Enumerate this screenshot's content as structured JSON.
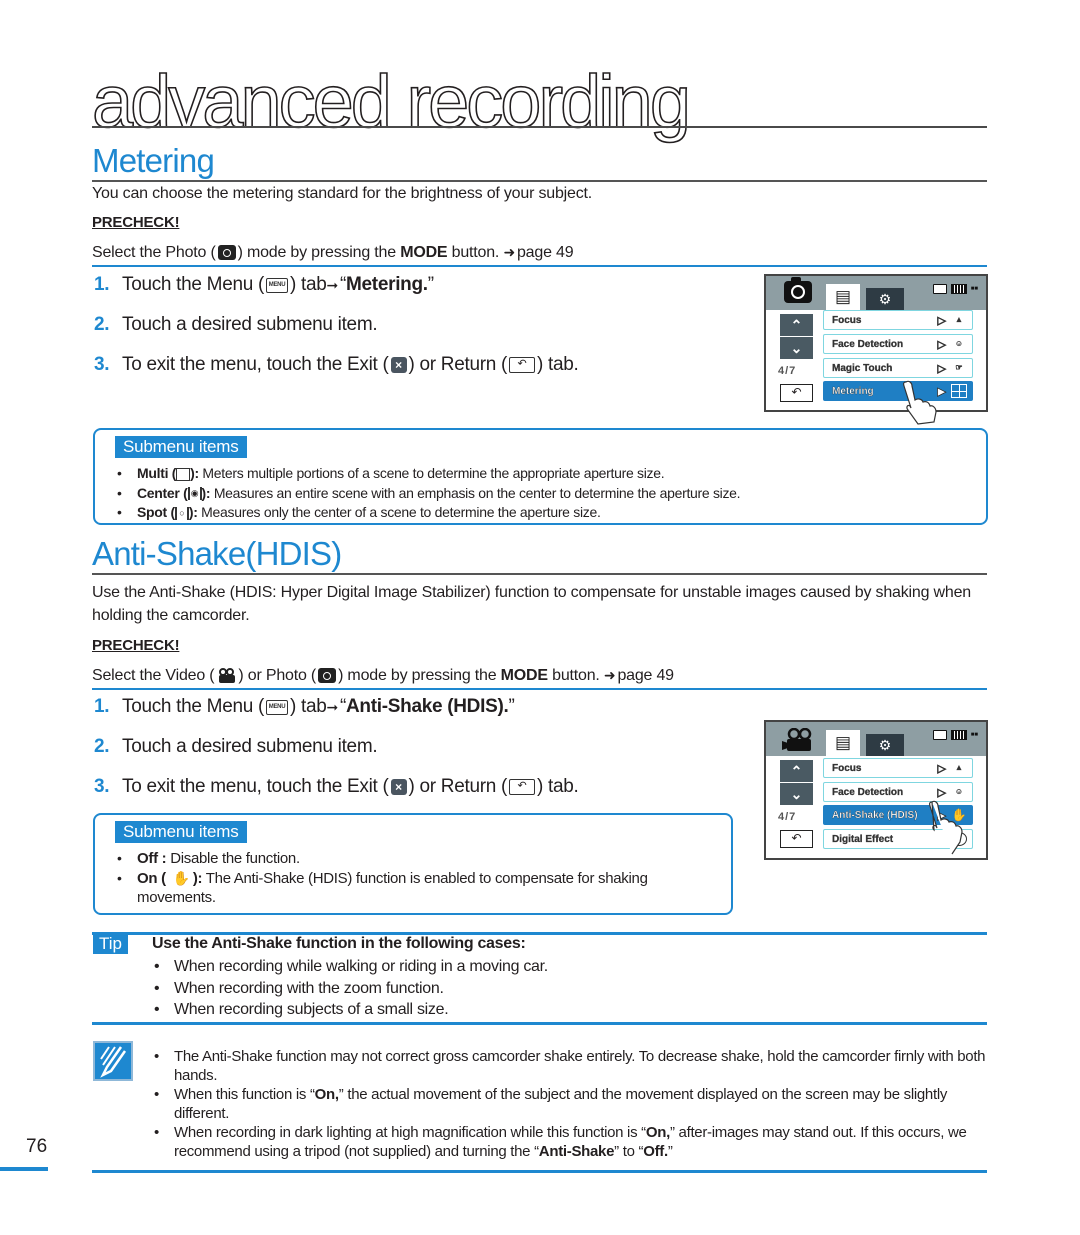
{
  "chapter": {
    "title": "advanced recording"
  },
  "metering": {
    "title": "Metering",
    "intro": "You can choose the metering standard for the brightness of your subject.",
    "precheck_label": "PRECHECK!",
    "precheck_pre": "Select the Photo (",
    "precheck_mid": ") mode by pressing the ",
    "precheck_mode": "MODE",
    "precheck_post": " button. ",
    "precheck_page": "page 49",
    "steps": [
      {
        "num": "1.",
        "pre": "Touch the Menu (",
        "icon": "MENU",
        "mid": ") tab ",
        "bold": "Metering.",
        "post": ""
      },
      {
        "num": "2.",
        "text": "Touch a desired submenu item."
      },
      {
        "num": "3.",
        "pre": "To exit the menu, touch the Exit (",
        "mid": ") or Return (",
        "post": ") tab."
      }
    ],
    "submenu_label": "Submenu items",
    "submenu": [
      {
        "name": "Multi (",
        "icon": "multi-metering-icon",
        "close": "):",
        "desc": " Meters multiple portions of a scene to determine the appropriate aperture size."
      },
      {
        "name": "Center (",
        "icon": "center-metering-icon",
        "close": "):",
        "desc": " Measures an entire scene with an emphasis on the center to determine the aperture size."
      },
      {
        "name": "Spot (",
        "icon": "spot-metering-icon",
        "close": "):",
        "desc": " Measures only the center of a scene to determine the aperture size."
      }
    ],
    "lcd": {
      "mode": "photo",
      "page": "4/7",
      "items": [
        {
          "label": "Focus",
          "icon": "AUTO",
          "selected": false
        },
        {
          "label": "Face Detection",
          "icon": "OFF",
          "selected": false
        },
        {
          "label": "Magic Touch",
          "icon": "OFF",
          "selected": false
        },
        {
          "label": "Metering",
          "icon": "multi",
          "selected": true
        }
      ]
    }
  },
  "antishake": {
    "title": "Anti-Shake(HDIS)",
    "intro": "Use the Anti-Shake (HDIS: Hyper Digital Image Stabilizer) function to compensate for unstable images caused by shaking when holding the camcorder.",
    "precheck_label": "PRECHECK!",
    "precheck_pre": "Select the Video (",
    "precheck_mid1": ") or Photo (",
    "precheck_mid2": ") mode by pressing the ",
    "precheck_mode": "MODE",
    "precheck_post": " button. ",
    "precheck_page": "page 49",
    "steps": [
      {
        "num": "1.",
        "pre": "Touch the Menu (",
        "icon": "MENU",
        "mid": ") tab ",
        "bold": "Anti-Shake (HDIS).",
        "post": ""
      },
      {
        "num": "2.",
        "text": "Touch a desired submenu item."
      },
      {
        "num": "3.",
        "pre": "To exit the menu, touch the Exit (",
        "mid": ") or Return (",
        "post": ") tab."
      }
    ],
    "submenu_label": "Submenu items",
    "submenu": [
      {
        "name": "Off :",
        "desc": " Disable the function."
      },
      {
        "name": "On (",
        "close": "):",
        "desc": " The Anti-Shake (HDIS) function is enabled to compensate for shaking movements."
      }
    ],
    "lcd": {
      "mode": "video",
      "page": "4/7",
      "items": [
        {
          "label": "Focus",
          "icon": "AUTO",
          "selected": false
        },
        {
          "label": "Face Detection",
          "icon": "OFF",
          "selected": false
        },
        {
          "label": "Anti-Shake (HDIS)",
          "icon": "hdis",
          "selected": true
        },
        {
          "label": "Digital Effect",
          "icon": "effect",
          "selected": false
        }
      ]
    }
  },
  "tip": {
    "tag": "Tip",
    "heading": "Use the Anti-Shake function in the following cases:",
    "items": [
      "When recording while walking or riding in a moving car.",
      "When recording with the zoom function.",
      "When recording subjects of a small size."
    ]
  },
  "notes": {
    "items": [
      {
        "parts": [
          {
            "t": "The Anti-Shake function may not correct gross camcorder shake entirely. To decrease shake, hold the camcorder firnly with both hands."
          }
        ]
      },
      {
        "parts": [
          {
            "t": "When this function is “"
          },
          {
            "b": "On,"
          },
          {
            "t": "” the actual movement of the subject and the movement displayed on the screen may be slightly different."
          }
        ]
      },
      {
        "parts": [
          {
            "t": "When recording in dark lighting at high magnification while this function is “"
          },
          {
            "b": "On,"
          },
          {
            "t": "” after-images may stand out. If this occurs, we recommend using a tripod (not supplied) and turning the “"
          },
          {
            "b": "Anti-Shake"
          },
          {
            "t": "” to “"
          },
          {
            "b": "Off."
          },
          {
            "t": "”"
          }
        ]
      }
    ]
  },
  "page": {
    "number": "76"
  },
  "colors": {
    "accent": "#1e88d0",
    "lcd_selected": "#1f7fc4",
    "lcd_header": "#8e9ea3",
    "text": "#231f20"
  }
}
